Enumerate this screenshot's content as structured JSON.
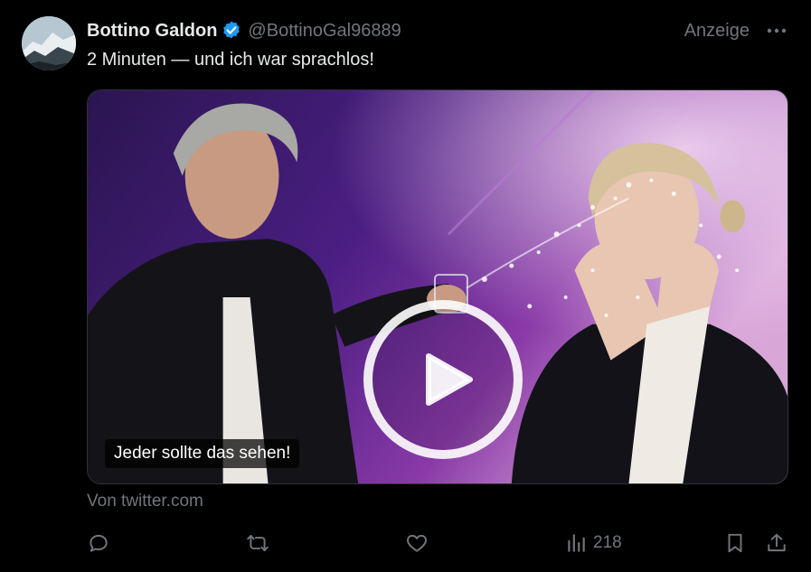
{
  "author": {
    "display_name": "Bottino Galdon",
    "handle": "@BottinoGal96889",
    "verified": true,
    "verified_badge_color": "#1d9bf0"
  },
  "ad_label": "Anzeige",
  "tweet": {
    "text": "2 Minuten — und ich war sprachlos!"
  },
  "media": {
    "type": "video",
    "caption": "Jeder sollte das sehen!"
  },
  "source_text": "Von twitter.com",
  "actions": {
    "reply_icon": "reply-icon",
    "retweet_icon": "retweet-icon",
    "like_icon": "heart-icon",
    "views_icon": "views-icon",
    "views_count": "218",
    "bookmark_icon": "bookmark-icon",
    "share_icon": "share-icon"
  },
  "colors": {
    "background": "#000000",
    "text_primary": "#e7e9ea",
    "text_secondary": "#71767b"
  }
}
